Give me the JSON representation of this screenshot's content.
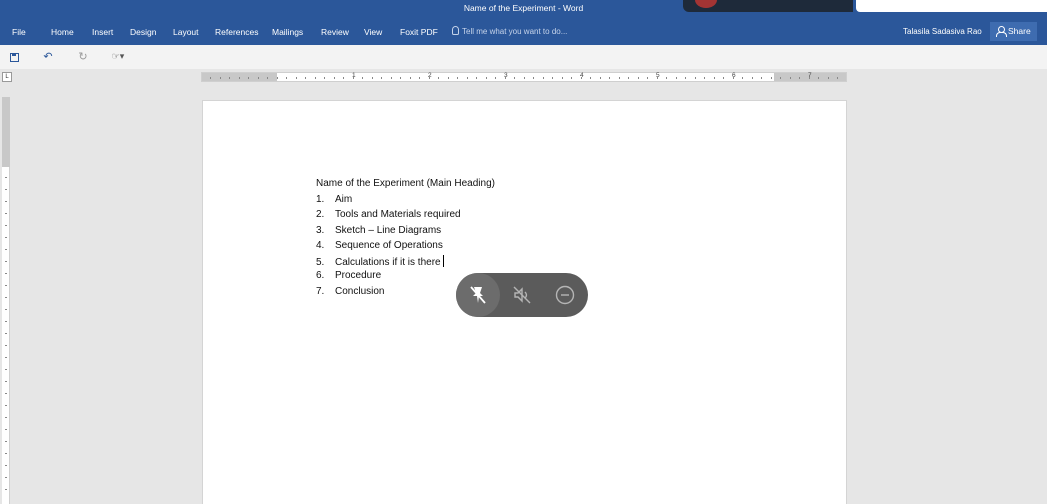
{
  "window": {
    "title": "Name of the Experiment - Word"
  },
  "ribbon": {
    "tabs": [
      "File",
      "Home",
      "Insert",
      "Design",
      "Layout",
      "References",
      "Mailings",
      "Review",
      "View",
      "Foxit PDF"
    ],
    "tell_me_placeholder": "Tell me what you want to do...",
    "user_name": "Talasila Sadasiva Rao",
    "share_label": "Share"
  },
  "ruler": {
    "numbers": [
      "1",
      "2",
      "3",
      "4",
      "5",
      "6",
      "7"
    ],
    "corner_label": "L"
  },
  "document": {
    "heading": "Name of the Experiment (Main Heading)",
    "items": [
      {
        "num": "1.",
        "text": "Aim"
      },
      {
        "num": "2.",
        "text": "Tools and Materials required"
      },
      {
        "num": "3.",
        "text": "Sketch – Line Diagrams"
      },
      {
        "num": "4.",
        "text": "Sequence of Operations"
      },
      {
        "num": "5.",
        "text": "Calculations if it is there"
      },
      {
        "num": "6.",
        "text": "Procedure"
      },
      {
        "num": "7.",
        "text": "Conclusion"
      }
    ]
  },
  "floating_toolbar": {
    "icons": [
      "pen-off-icon",
      "mute-icon",
      "minimize-icon"
    ]
  },
  "colors": {
    "word_blue": "#2b579a",
    "toolbar_gray": "#5b5b5b"
  }
}
